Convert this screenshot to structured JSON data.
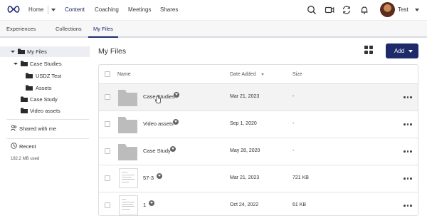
{
  "nav": {
    "home": "Home",
    "content": "Content",
    "coaching": "Coaching",
    "meetings": "Meetings",
    "shares": "Shares",
    "user_name": "Test",
    "accent": "#1d2a6e"
  },
  "tabs": [
    "Experiences",
    "Collections",
    "My Files"
  ],
  "sidebar": {
    "tree": [
      {
        "label": "My Files"
      },
      {
        "label": "Case Studies"
      },
      {
        "label": "USDZ Test"
      },
      {
        "label": "Assets"
      },
      {
        "label": "Case Study"
      },
      {
        "label": "Video assets"
      }
    ],
    "shared": "Shared with me",
    "recent": "Recent",
    "storage": "182.2 MB used"
  },
  "main": {
    "title": "My Files",
    "add_label": "Add",
    "add_color": "#1f2a6b",
    "columns": {
      "name": "Name",
      "date": "Date Added",
      "size": "Size"
    },
    "rows": [
      {
        "name": "Case Studies",
        "date": "Mar 21, 2023",
        "size": "-",
        "kind": "folder"
      },
      {
        "name": "Video assets",
        "date": "Sep 1, 2020",
        "size": "-",
        "kind": "folder"
      },
      {
        "name": "Case Study",
        "date": "May 28, 2020",
        "size": "-",
        "kind": "folder"
      },
      {
        "name": "57-3",
        "date": "Mar 21, 2023",
        "size": "721 KB",
        "kind": "file"
      },
      {
        "name": "1",
        "date": "Oct 24, 2022",
        "size": "61 KB",
        "kind": "file"
      }
    ]
  }
}
